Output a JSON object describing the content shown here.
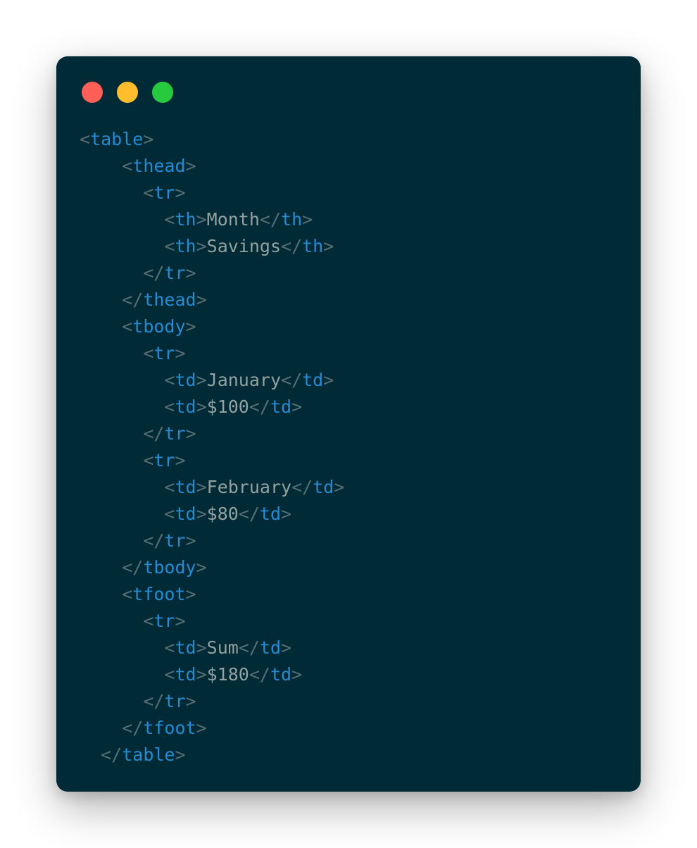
{
  "window": {
    "controls": [
      {
        "name": "close-button",
        "color": "#ff5f56"
      },
      {
        "name": "minimize-button",
        "color": "#ffbd2e"
      },
      {
        "name": "maximize-button",
        "color": "#27c93f"
      }
    ]
  },
  "colors": {
    "background": "#002b36",
    "tag": "#268bd2",
    "bracket": "#586e75",
    "text": "#93a1a1"
  },
  "code": [
    {
      "indent": "",
      "parts": [
        {
          "t": "p",
          "v": "<"
        },
        {
          "t": "tag",
          "v": "table"
        },
        {
          "t": "p",
          "v": ">"
        }
      ]
    },
    {
      "indent": "    ",
      "parts": [
        {
          "t": "p",
          "v": "<"
        },
        {
          "t": "tag",
          "v": "thead"
        },
        {
          "t": "p",
          "v": ">"
        }
      ]
    },
    {
      "indent": "      ",
      "parts": [
        {
          "t": "p",
          "v": "<"
        },
        {
          "t": "tag",
          "v": "tr"
        },
        {
          "t": "p",
          "v": ">"
        }
      ]
    },
    {
      "indent": "        ",
      "parts": [
        {
          "t": "p",
          "v": "<"
        },
        {
          "t": "tag",
          "v": "th"
        },
        {
          "t": "p",
          "v": ">"
        },
        {
          "t": "text",
          "v": "Month"
        },
        {
          "t": "p",
          "v": "</"
        },
        {
          "t": "tag",
          "v": "th"
        },
        {
          "t": "p",
          "v": ">"
        }
      ]
    },
    {
      "indent": "        ",
      "parts": [
        {
          "t": "p",
          "v": "<"
        },
        {
          "t": "tag",
          "v": "th"
        },
        {
          "t": "p",
          "v": ">"
        },
        {
          "t": "text",
          "v": "Savings"
        },
        {
          "t": "p",
          "v": "</"
        },
        {
          "t": "tag",
          "v": "th"
        },
        {
          "t": "p",
          "v": ">"
        }
      ]
    },
    {
      "indent": "      ",
      "parts": [
        {
          "t": "p",
          "v": "</"
        },
        {
          "t": "tag",
          "v": "tr"
        },
        {
          "t": "p",
          "v": ">"
        }
      ]
    },
    {
      "indent": "    ",
      "parts": [
        {
          "t": "p",
          "v": "</"
        },
        {
          "t": "tag",
          "v": "thead"
        },
        {
          "t": "p",
          "v": ">"
        }
      ]
    },
    {
      "indent": "    ",
      "parts": [
        {
          "t": "p",
          "v": "<"
        },
        {
          "t": "tag",
          "v": "tbody"
        },
        {
          "t": "p",
          "v": ">"
        }
      ]
    },
    {
      "indent": "      ",
      "parts": [
        {
          "t": "p",
          "v": "<"
        },
        {
          "t": "tag",
          "v": "tr"
        },
        {
          "t": "p",
          "v": ">"
        }
      ]
    },
    {
      "indent": "        ",
      "parts": [
        {
          "t": "p",
          "v": "<"
        },
        {
          "t": "tag",
          "v": "td"
        },
        {
          "t": "p",
          "v": ">"
        },
        {
          "t": "text",
          "v": "January"
        },
        {
          "t": "p",
          "v": "</"
        },
        {
          "t": "tag",
          "v": "td"
        },
        {
          "t": "p",
          "v": ">"
        }
      ]
    },
    {
      "indent": "        ",
      "parts": [
        {
          "t": "p",
          "v": "<"
        },
        {
          "t": "tag",
          "v": "td"
        },
        {
          "t": "p",
          "v": ">"
        },
        {
          "t": "text",
          "v": "$100"
        },
        {
          "t": "p",
          "v": "</"
        },
        {
          "t": "tag",
          "v": "td"
        },
        {
          "t": "p",
          "v": ">"
        }
      ]
    },
    {
      "indent": "      ",
      "parts": [
        {
          "t": "p",
          "v": "</"
        },
        {
          "t": "tag",
          "v": "tr"
        },
        {
          "t": "p",
          "v": ">"
        }
      ]
    },
    {
      "indent": "      ",
      "parts": [
        {
          "t": "p",
          "v": "<"
        },
        {
          "t": "tag",
          "v": "tr"
        },
        {
          "t": "p",
          "v": ">"
        }
      ]
    },
    {
      "indent": "        ",
      "parts": [
        {
          "t": "p",
          "v": "<"
        },
        {
          "t": "tag",
          "v": "td"
        },
        {
          "t": "p",
          "v": ">"
        },
        {
          "t": "text",
          "v": "February"
        },
        {
          "t": "p",
          "v": "</"
        },
        {
          "t": "tag",
          "v": "td"
        },
        {
          "t": "p",
          "v": ">"
        }
      ]
    },
    {
      "indent": "        ",
      "parts": [
        {
          "t": "p",
          "v": "<"
        },
        {
          "t": "tag",
          "v": "td"
        },
        {
          "t": "p",
          "v": ">"
        },
        {
          "t": "text",
          "v": "$80"
        },
        {
          "t": "p",
          "v": "</"
        },
        {
          "t": "tag",
          "v": "td"
        },
        {
          "t": "p",
          "v": ">"
        }
      ]
    },
    {
      "indent": "      ",
      "parts": [
        {
          "t": "p",
          "v": "</"
        },
        {
          "t": "tag",
          "v": "tr"
        },
        {
          "t": "p",
          "v": ">"
        }
      ]
    },
    {
      "indent": "    ",
      "parts": [
        {
          "t": "p",
          "v": "</"
        },
        {
          "t": "tag",
          "v": "tbody"
        },
        {
          "t": "p",
          "v": ">"
        }
      ]
    },
    {
      "indent": "    ",
      "parts": [
        {
          "t": "p",
          "v": "<"
        },
        {
          "t": "tag",
          "v": "tfoot"
        },
        {
          "t": "p",
          "v": ">"
        }
      ]
    },
    {
      "indent": "      ",
      "parts": [
        {
          "t": "p",
          "v": "<"
        },
        {
          "t": "tag",
          "v": "tr"
        },
        {
          "t": "p",
          "v": ">"
        }
      ]
    },
    {
      "indent": "        ",
      "parts": [
        {
          "t": "p",
          "v": "<"
        },
        {
          "t": "tag",
          "v": "td"
        },
        {
          "t": "p",
          "v": ">"
        },
        {
          "t": "text",
          "v": "Sum"
        },
        {
          "t": "p",
          "v": "</"
        },
        {
          "t": "tag",
          "v": "td"
        },
        {
          "t": "p",
          "v": ">"
        }
      ]
    },
    {
      "indent": "        ",
      "parts": [
        {
          "t": "p",
          "v": "<"
        },
        {
          "t": "tag",
          "v": "td"
        },
        {
          "t": "p",
          "v": ">"
        },
        {
          "t": "text",
          "v": "$180"
        },
        {
          "t": "p",
          "v": "</"
        },
        {
          "t": "tag",
          "v": "td"
        },
        {
          "t": "p",
          "v": ">"
        }
      ]
    },
    {
      "indent": "      ",
      "parts": [
        {
          "t": "p",
          "v": "</"
        },
        {
          "t": "tag",
          "v": "tr"
        },
        {
          "t": "p",
          "v": ">"
        }
      ]
    },
    {
      "indent": "    ",
      "parts": [
        {
          "t": "p",
          "v": "</"
        },
        {
          "t": "tag",
          "v": "tfoot"
        },
        {
          "t": "p",
          "v": ">"
        }
      ]
    },
    {
      "indent": "  ",
      "parts": [
        {
          "t": "p",
          "v": "</"
        },
        {
          "t": "tag",
          "v": "table"
        },
        {
          "t": "p",
          "v": ">"
        }
      ]
    }
  ]
}
